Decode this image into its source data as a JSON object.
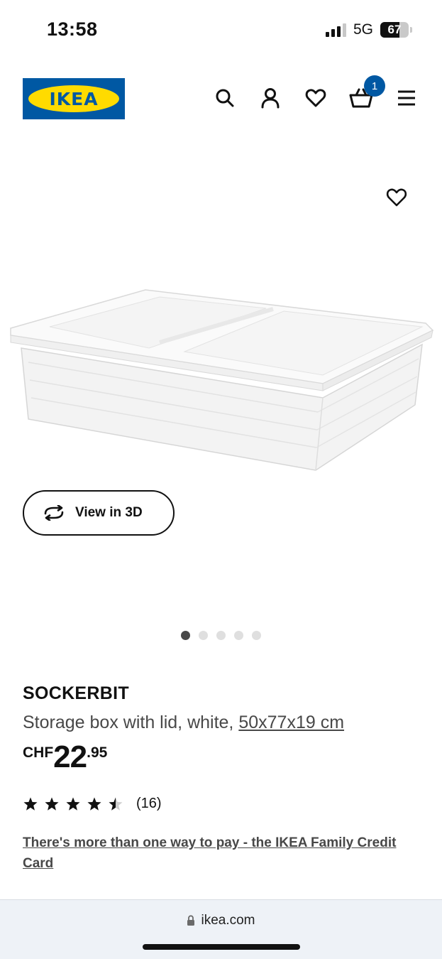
{
  "status_bar": {
    "time": "13:58",
    "network": "5G",
    "battery": "67",
    "battery_level": 0.67
  },
  "header": {
    "logo_text": "IKEA",
    "cart_count": "1",
    "icons": [
      "search-icon",
      "user-icon",
      "heart-icon",
      "cart-icon",
      "menu-icon"
    ]
  },
  "gallery": {
    "view_3d_label": "View in 3D",
    "image_count": 5,
    "active_index": 0
  },
  "product": {
    "name": "SOCKERBIT",
    "description": "Storage box with lid, white, ",
    "size": "50x77x19 cm",
    "price_currency": "CHF",
    "price_integer": "22",
    "price_decimal": ".95",
    "rating": 4.5,
    "review_count": "(16)",
    "pay_link": "There's more than one way to pay - the IKEA Family Credit Card"
  },
  "browser": {
    "url": "ikea.com"
  },
  "colors": {
    "brand_blue": "#0058a3",
    "brand_yellow": "#ffdb00",
    "text": "#111111",
    "muted_text": "#484848"
  }
}
